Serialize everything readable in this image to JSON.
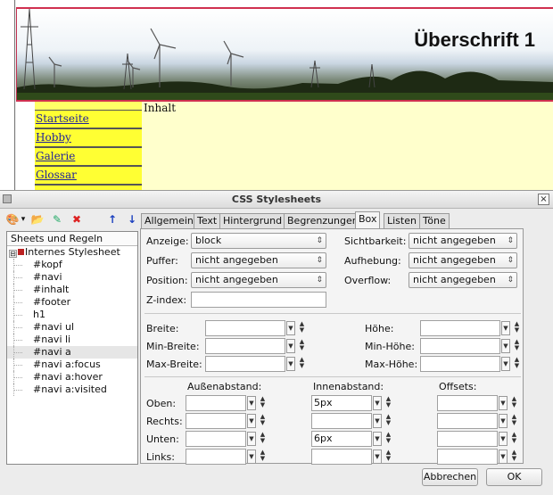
{
  "preview": {
    "header_title": "Überschrift 1",
    "content_label": "Inhalt",
    "nav_items": [
      "Startseite",
      "Hobby",
      "Galerie",
      "Glossar",
      ""
    ]
  },
  "dialog": {
    "title": "CSS Stylesheets",
    "close_glyph": "×",
    "toolbar": {
      "icons": [
        "palette-icon",
        "dropdown-arrow-icon",
        "open-sheet-icon",
        "edit-rule-icon",
        "delete-icon",
        "move-up-icon",
        "move-down-icon"
      ],
      "glyphs": [
        "🎨",
        "▾",
        "📂",
        "✎",
        "✖",
        "↑",
        "↓"
      ]
    },
    "tree": {
      "header": "Sheets und Regeln",
      "root": "Internes Stylesheet",
      "root_expander": "⊟",
      "rules": [
        "#kopf",
        "#navi",
        "#inhalt",
        "#footer",
        "h1",
        "#navi ul",
        "#navi li",
        "#navi a",
        "#navi a:focus",
        "#navi a:hover",
        "#navi a:visited"
      ],
      "selected_index": 7
    },
    "tabs": [
      "Allgemein",
      "Text",
      "Hintergrund",
      "Begrenzungen",
      "Box",
      "Listen",
      "Töne"
    ],
    "active_tab": "Box",
    "box": {
      "anzeige_label": "Anzeige:",
      "anzeige_value": "block",
      "puffer_label": "Puffer:",
      "puffer_value": "nicht angegeben",
      "position_label": "Position:",
      "position_value": "nicht angegeben",
      "zindex_label": "Z-index:",
      "zindex_value": "",
      "sichtbarkeit_label": "Sichtbarkeit:",
      "sichtbarkeit_value": "nicht angegeben",
      "aufhebung_label": "Aufhebung:",
      "aufhebung_value": "nicht angegeben",
      "overflow_label": "Overflow:",
      "overflow_value": "nicht angegeben",
      "breite_label": "Breite:",
      "min_breite_label": "Min-Breite:",
      "max_breite_label": "Max-Breite:",
      "hoehe_label": "Höhe:",
      "min_hoehe_label": "Min-Höhe:",
      "max_hoehe_label": "Max-Höhe:",
      "aussenabstand_label": "Außenabstand:",
      "innenabstand_label": "Innenabstand:",
      "offsets_label": "Offsets:",
      "oben_label": "Oben:",
      "rechts_label": "Rechts:",
      "unten_label": "Unten:",
      "links_label": "Links:",
      "inner_oben_value": "5px",
      "inner_unten_value": "6px"
    },
    "buttons": {
      "cancel": "Abbrechen",
      "ok": "OK"
    }
  }
}
